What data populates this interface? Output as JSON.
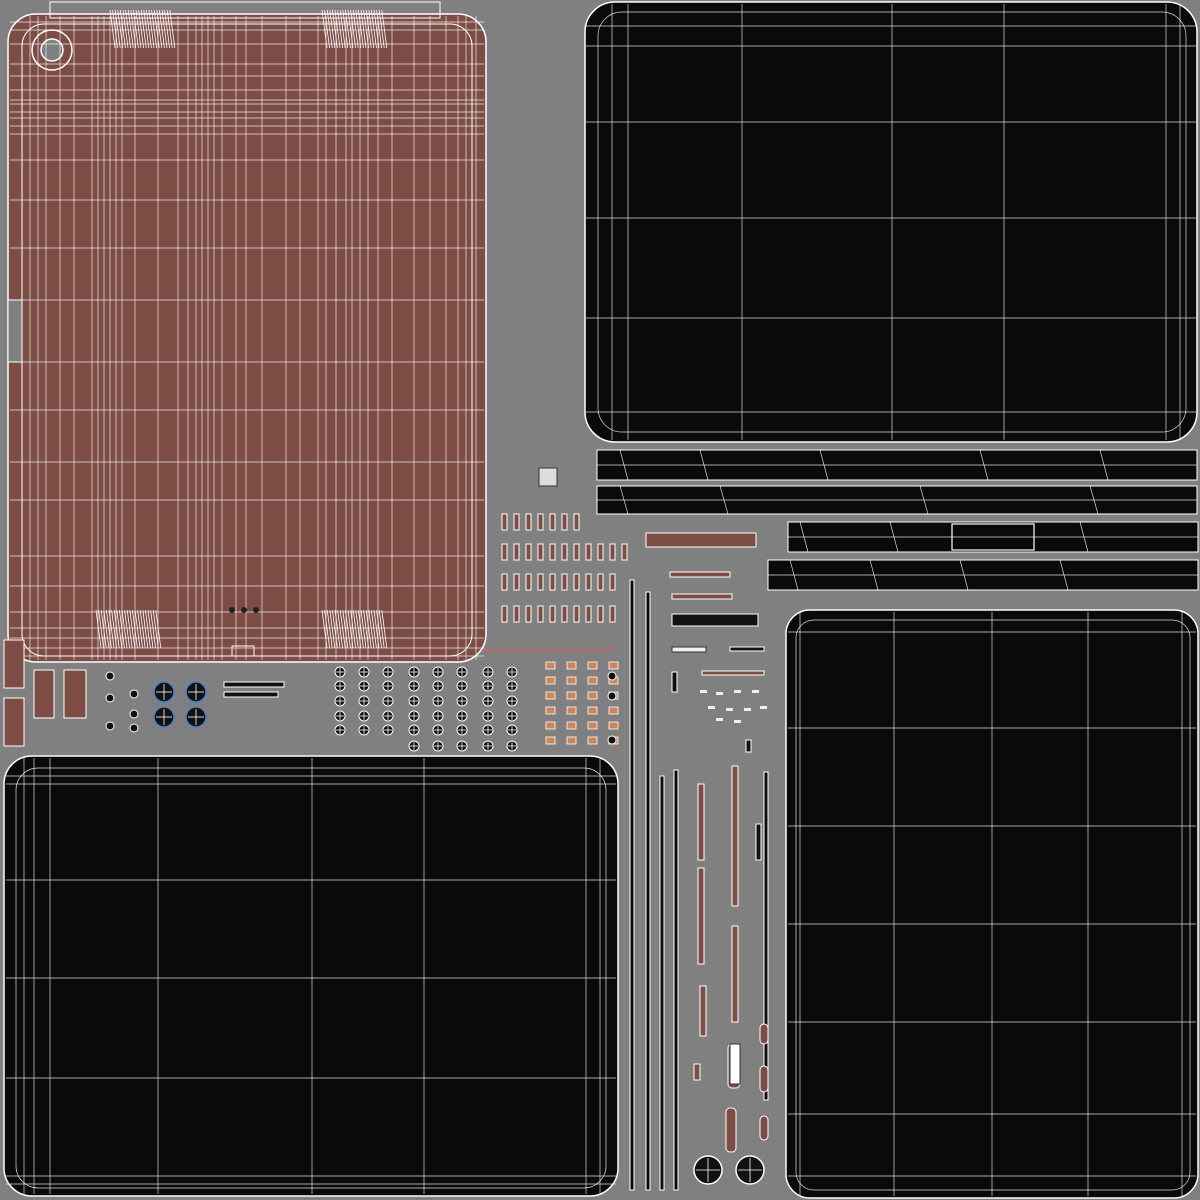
{
  "uv_layout": {
    "background_color": "#808080",
    "shell_color": "#7d4d45",
    "screen_color": "#0a0a0a",
    "wire_color": "#ffffff",
    "islands": [
      {
        "id": "back-shell",
        "kind": "shell"
      },
      {
        "id": "screen-top-right",
        "kind": "screen"
      },
      {
        "id": "screen-bottom-left",
        "kind": "screen"
      },
      {
        "id": "screen-bottom-right",
        "kind": "screen"
      },
      {
        "id": "edge-strips",
        "kind": "strip"
      },
      {
        "id": "button-parts",
        "kind": "small-parts"
      },
      {
        "id": "screw-heads",
        "kind": "small-parts"
      },
      {
        "id": "vertical-rails",
        "kind": "strip"
      }
    ]
  }
}
